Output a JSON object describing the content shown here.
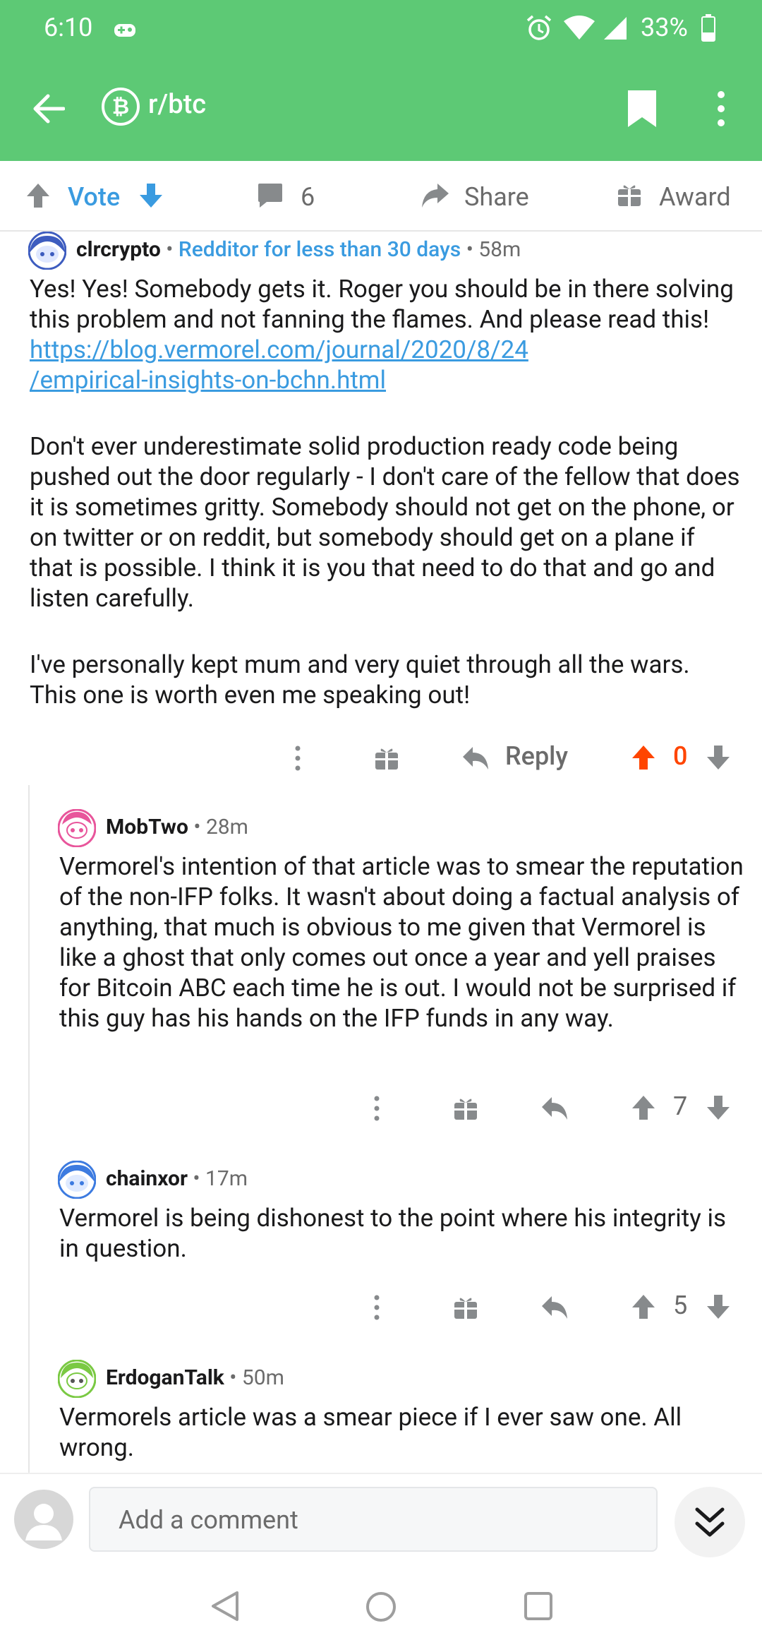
{
  "status": {
    "time": "6:10",
    "battery": "33%"
  },
  "header": {
    "subreddit": "r/btc"
  },
  "actions": {
    "vote_label": "Vote",
    "comments_count": "6",
    "share_label": "Share",
    "award_label": "Award"
  },
  "comments": [
    {
      "author": "clrcrypto",
      "flair": "Redditor for less than 30 days",
      "time": "58m",
      "p1": "Yes!  Yes!  Somebody gets it.  Roger you should be in there solving this problem and not fanning the flames.  And please read this! ",
      "link1": "https://blog.vermorel.com/journal/2020/8/24",
      "link2": "/empirical-insights-on-bchn.html",
      "p2": "Don't ever underestimate solid production ready code being pushed out the door regularly - I don't care of the fellow that does it is sometimes gritty.  Somebody should not get on the phone, or on twitter or on reddit, but somebody should get on a plane if that is possible.  I think it is you that need to do that and go and listen carefully.",
      "p3": "I've personally kept mum and very quiet through all the wars.  This one is worth even me speaking out!",
      "reply_label": "Reply",
      "score": "0"
    },
    {
      "author": "MobTwo",
      "time": "28m",
      "body": "Vermorel's intention of that article was to smear the reputation of the non-IFP folks. It wasn't about doing a factual analysis of anything, that much is obvious to me given that Vermorel is like a ghost that only comes out once a year and yell praises for Bitcoin ABC each time he is out. I would not be surprised if this guy has his hands on the IFP funds in any way.",
      "score": "7"
    },
    {
      "author": "chainxor",
      "time": "17m",
      "body": "Vermorel is being dishonest to the point where his integrity is in question.",
      "score": "5"
    },
    {
      "author": "ErdoganTalk",
      "time": "50m",
      "body": "Vermorels article was a smear piece if I ever saw one. All wrong."
    }
  ],
  "composer": {
    "placeholder": "Add a comment"
  },
  "colors": {
    "brand_green": "#5dc975",
    "link_blue": "#3a9be0",
    "upvote_orange": "#ff4500"
  }
}
